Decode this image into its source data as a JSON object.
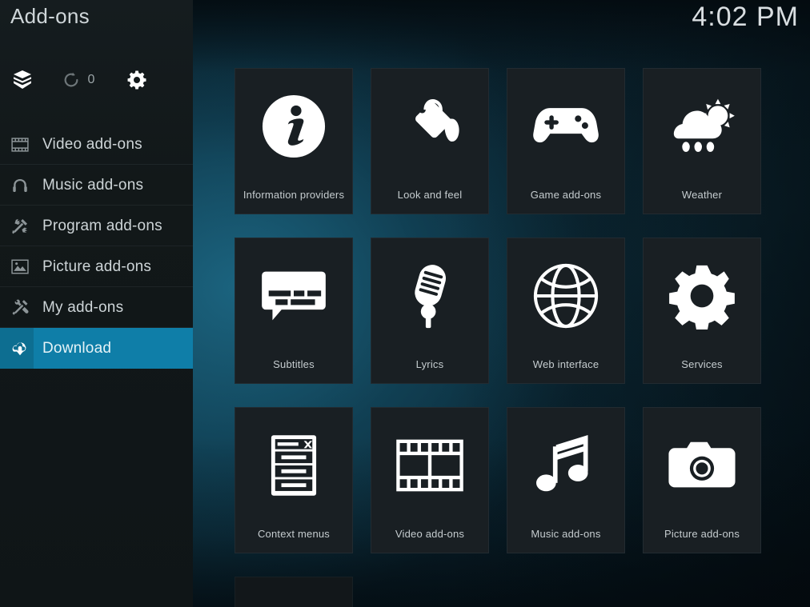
{
  "window": {
    "title": "Add-ons",
    "clock": "4:02 PM"
  },
  "colors": {
    "accent": "#0f7ea8",
    "accent_dark": "#0d6e91",
    "tile_bg": "#191f23",
    "sidebar_bg": "#151c1f",
    "text": "#cdd4d7"
  },
  "sidebar": {
    "title": "Add-ons",
    "actions": [
      {
        "name": "install-from-repository-icon",
        "label": ""
      },
      {
        "name": "check-for-updates-icon",
        "label": "",
        "count": "0"
      },
      {
        "name": "settings-gear-icon",
        "label": ""
      }
    ],
    "items": [
      {
        "label": "Video add-ons",
        "icon": "film-strip-icon",
        "selected": false
      },
      {
        "label": "Music add-ons",
        "icon": "headphones-icon",
        "selected": false
      },
      {
        "label": "Program add-ons",
        "icon": "program-tools-icon",
        "selected": false
      },
      {
        "label": "Picture add-ons",
        "icon": "picture-frame-icon",
        "selected": false
      },
      {
        "label": "My add-ons",
        "icon": "my-addons-icon",
        "selected": false
      },
      {
        "label": "Download",
        "icon": "cloud-download-icon",
        "selected": true
      }
    ]
  },
  "grid": {
    "rows": [
      [
        {
          "label": "Information providers",
          "icon": "info-circle-icon"
        },
        {
          "label": "Look and feel",
          "icon": "paint-tag-icon"
        },
        {
          "label": "Game add-ons",
          "icon": "gamepad-icon"
        },
        {
          "label": "Weather",
          "icon": "weather-cloud-sun-rain-icon"
        }
      ],
      [
        {
          "label": "Subtitles",
          "icon": "speech-bubble-subtitle-icon"
        },
        {
          "label": "Lyrics",
          "icon": "microphone-icon"
        },
        {
          "label": "Web interface",
          "icon": "globe-icon"
        },
        {
          "label": "Services",
          "icon": "gear-icon"
        }
      ],
      [
        {
          "label": "Context menus",
          "icon": "context-menu-list-icon"
        },
        {
          "label": "Video add-ons",
          "icon": "film-strip-icon"
        },
        {
          "label": "Music add-ons",
          "icon": "music-note-icon"
        },
        {
          "label": "Picture add-ons",
          "icon": "camera-icon"
        }
      ],
      [
        {
          "label": "",
          "icon": "partial-tile"
        }
      ]
    ]
  }
}
